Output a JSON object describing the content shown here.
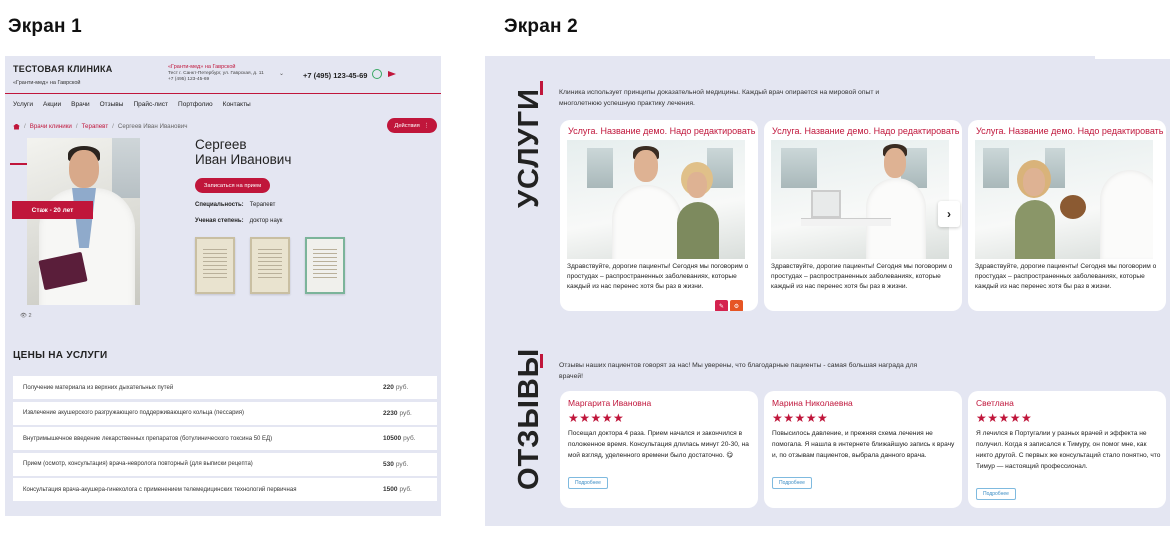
{
  "labels": {
    "screen1": "Экран 1",
    "screen2": "Экран 2"
  },
  "screen1": {
    "brand": "ТЕСТОВАЯ КЛИНИКА",
    "brand_sub": "«Гранти-мед» на Гаврской",
    "branch_link": "«Гранти-мед» на Гаврской",
    "address": "Тест г. Санкт-Петербург, ул. Гаврская, д. 11",
    "branch_phone": "+7 (495) 123-45-69",
    "phone": "+7 (495) 123-45-69",
    "nav": [
      "Услуги",
      "Акции",
      "Врачи",
      "Отзывы",
      "Прайс-лист",
      "Портфолио",
      "Контакты"
    ],
    "breadcrumbs": [
      "Врачи клиники",
      "Терапевт",
      "Сергеев Иван Иванович"
    ],
    "actions_label": "Действия",
    "experience": "Стаж - 20 лет",
    "doctor_last": "Сергеев",
    "doctor_first": "Иван Иванович",
    "signup_label": "Записаться на прием",
    "spec_label": "Специальность:",
    "spec_value": "Терапевт",
    "degree_label": "Ученая степень:",
    "degree_value": "доктор наук",
    "views": "2",
    "prices_title": "ЦЕНЫ НА УСЛУГИ",
    "currency": "руб.",
    "prices": [
      {
        "name": "Получение материала из верхних дыхательных путей",
        "price": "220"
      },
      {
        "name": "Извлечение акушерского разгружающего поддерживающего кольца (пессария)",
        "price": "2230"
      },
      {
        "name": "Внутримышечное введение лекарственных препаратов (ботулинического токсина 50 ЕД)",
        "price": "10500"
      },
      {
        "name": "Прием (осмотр, консультация) врача-невролога повторный (для выписки рецепта)",
        "price": "530"
      },
      {
        "name": "Консультация врача-акушера-гинеколога с применением телемедицинских технологий первичная",
        "price": "1500"
      }
    ]
  },
  "screen2": {
    "services_title": "УСЛУГИ",
    "services_intro": "Клиника использует принципы доказательной медицины. Каждый врач опирается на мировой опыт и многолетнюю успешную практику лечения.",
    "service_title": "Услуга. Название демо. Надо редактировать",
    "service_text": "Здравствуйте, дорогие пациенты! Сегодня мы поговорим о простудах – распространенных заболеваниях, которые каждый из нас перенес хотя бы раз в жизни.",
    "reviews_title": "ОТЗЫВЫ",
    "reviews_intro": "Отзывы наших пациентов говорят за нас! Мы уверены, что благодарные пациенты - самая большая награда для врачей!",
    "stars": "★★★★★",
    "more_label": "Подробнее",
    "reviews": [
      {
        "name": "Маргарита Ивановна",
        "text": "Посещал доктора 4 раза. Прием начался и закончился в положенное время. Консультация длилась минут 20-30, на мой взгляд, уделенного времени было достаточно. 😋"
      },
      {
        "name": "Марина Николаевна",
        "text": "Повысилось давление, и прежняя схема лечения не помогала. Я нашла в интернете ближайшую запись к врачу и, по отзывам пациентов, выбрала данного врача."
      },
      {
        "name": "Светлана",
        "text": "Я лечился в Португалии у разных врачей и эффекта не получил. Когда я записался к Тимуру, он помог мне, как никто другой. С первых же консультаций стало понятно, что Тимур — настоящий профессионал."
      }
    ]
  }
}
